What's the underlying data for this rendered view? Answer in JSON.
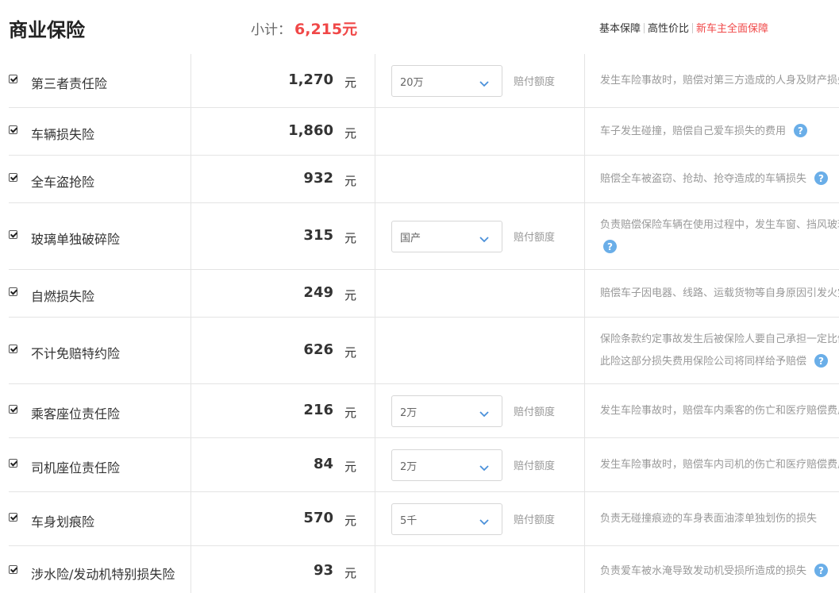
{
  "header": {
    "title": "商业保险",
    "subtotal_label": "小计：",
    "subtotal_value": "6,215元",
    "plans": [
      {
        "label": "基本保障",
        "active": false
      },
      {
        "label": "高性价比",
        "active": false
      },
      {
        "label": "新车主全面保障",
        "active": true
      }
    ]
  },
  "colors": {
    "accent_red": "#f04848",
    "help_blue": "#6aaee8",
    "text_gray": "#999999"
  },
  "rows": [
    {
      "name": "第三者责任险",
      "price": "1,270",
      "unit": "元",
      "checked": true,
      "select": "20万",
      "coverage_label": "赔付额度",
      "desc": [
        "发生车险事故时，赔偿对第三方造成的人身及财产损失"
      ],
      "help": false
    },
    {
      "name": "车辆损失险",
      "price": "1,860",
      "unit": "元",
      "checked": true,
      "select": null,
      "coverage_label": null,
      "desc": [
        "车子发生碰撞，赔偿自己爱车损失的费用"
      ],
      "help": true
    },
    {
      "name": "全车盗抢险",
      "price": "932",
      "unit": "元",
      "checked": true,
      "select": null,
      "coverage_label": null,
      "desc": [
        "赔偿全车被盗窃、抢劫、抢夺造成的车辆损失"
      ],
      "help": true
    },
    {
      "name": "玻璃单独破碎险",
      "price": "315",
      "unit": "元",
      "checked": true,
      "select": "国产",
      "coverage_label": "赔付额度",
      "desc": [
        "负责赔偿保险车辆在使用过程中，发生车窗、挡风玻璃单独破碎的损失"
      ],
      "help": true,
      "help_newline": true
    },
    {
      "name": "自燃损失险",
      "price": "249",
      "unit": "元",
      "checked": true,
      "select": null,
      "coverage_label": null,
      "desc": [
        "赔偿车子因电器、线路、运载货物等自身原因引发火灾的损失"
      ],
      "help": false
    },
    {
      "name": "不计免赔特约险",
      "price": "626",
      "unit": "元",
      "checked": true,
      "select": null,
      "coverage_label": null,
      "desc": [
        "保险条款约定事故发生后被保险人要自己承担一定比例的损失，",
        "此险这部分损失费用保险公司将同样给予赔偿"
      ],
      "help": true
    },
    {
      "name": "乘客座位责任险",
      "price": "216",
      "unit": "元",
      "checked": true,
      "select": "2万",
      "coverage_label": "赔付额度",
      "desc": [
        "发生车险事故时，赔偿车内乘客的伤亡和医疗赔偿费用"
      ],
      "help": false
    },
    {
      "name": "司机座位责任险",
      "price": "84",
      "unit": "元",
      "checked": true,
      "select": "2万",
      "coverage_label": "赔付额度",
      "desc": [
        "发生车险事故时，赔偿车内司机的伤亡和医疗赔偿费用"
      ],
      "help": false
    },
    {
      "name": "车身划痕险",
      "price": "570",
      "unit": "元",
      "checked": true,
      "select": "5千",
      "coverage_label": "赔付额度",
      "desc": [
        "负责无碰撞痕迹的车身表面油漆单独划伤的损失"
      ],
      "help": false
    },
    {
      "name": "涉水险/发动机特别损失险",
      "price": "93",
      "unit": "元",
      "checked": true,
      "select": null,
      "coverage_label": null,
      "desc": [
        "负责爱车被水淹导致发动机受损所造成的损失"
      ],
      "help": true
    }
  ]
}
